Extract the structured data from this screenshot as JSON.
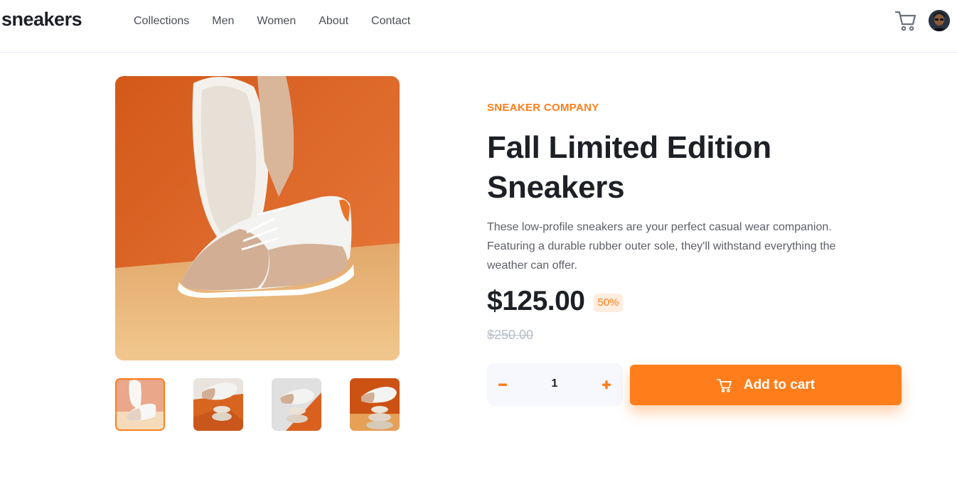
{
  "header": {
    "logo": "sneakers",
    "nav": [
      "Collections",
      "Men",
      "Women",
      "About",
      "Contact"
    ],
    "cart_icon": "cart-icon",
    "avatar_icon": "avatar"
  },
  "gallery": {
    "main_image": "sneaker-product-photo",
    "thumbnails": [
      "thumbnail-1",
      "thumbnail-2",
      "thumbnail-3",
      "thumbnail-4"
    ],
    "active_thumbnail_index": 0
  },
  "product": {
    "company": "SNEAKER COMPANY",
    "title": "Fall Limited Edition Sneakers",
    "description": "These low-profile sneakers are your perfect casual wear companion. Featuring a durable rubber outer sole, they'll withstand everything the weather can offer.",
    "price": "$125.00",
    "discount": "50%",
    "original_price": "$250.00"
  },
  "cart_controls": {
    "quantity": "1",
    "minus_icon": "minus-icon",
    "plus_icon": "plus-icon",
    "add_to_cart_label": "Add to cart"
  },
  "colors": {
    "accent": "#ff7e1b",
    "accent_light": "#ffede0",
    "dark": "#1d2026",
    "text_gray": "#5d6068",
    "muted": "#b6bcc8",
    "qty_bg": "#f6f8fd"
  }
}
